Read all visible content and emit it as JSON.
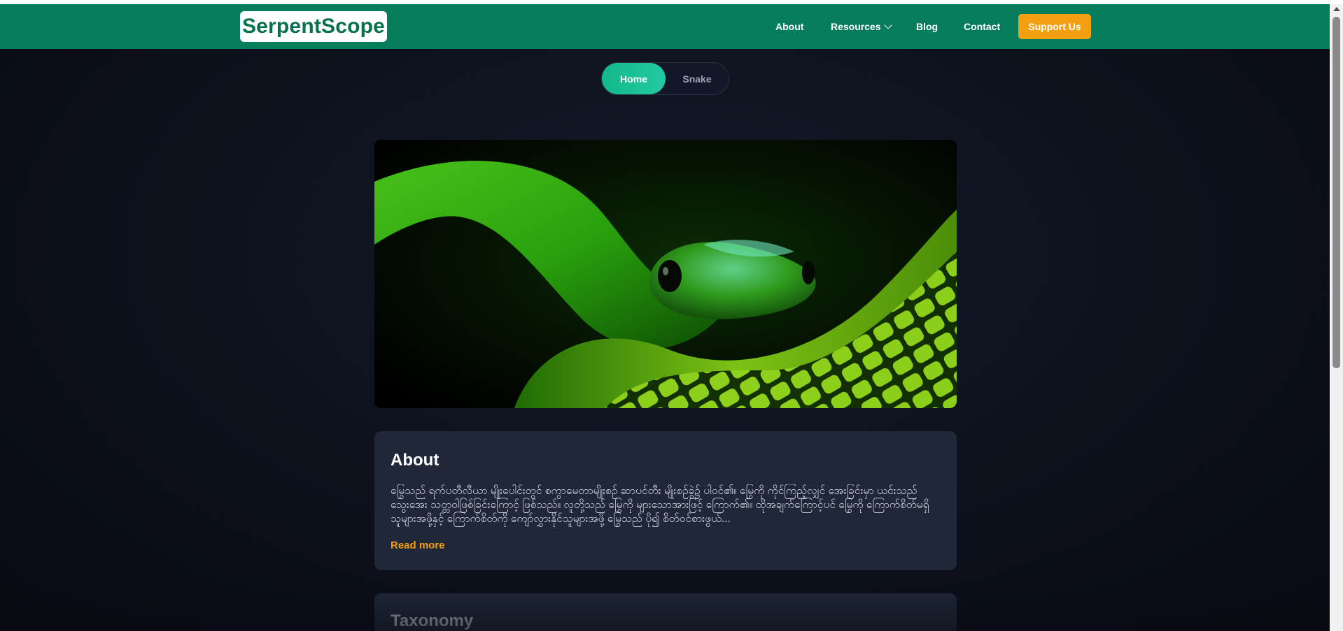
{
  "navbar": {
    "logo": "SerpentScope",
    "links": {
      "about": "About",
      "resources": "Resources",
      "blog": "Blog",
      "contact": "Contact"
    },
    "cta": "Support Us"
  },
  "tabs": {
    "home": "Home",
    "snake": "Snake"
  },
  "about_card": {
    "title": "About",
    "text": "မြွေသည် ရက်ပတီလီယာ မျိုးပေါင်းတွင် စကွာမေတာမျိုးစဉ် ဆာပင်တီး မျိုးစဉ်ခွဲ၌ ပါဝင်၏။ မြွေကို ကိုင်ကြည့်လျှင် အေးခြင်းမှာ ယင်းသည် သွေးအေး သတ္တဝါဖြစ်ခြင်းကြောင့် ဖြစ်သည်။ လူတို့သည် မြွေကို များသောအားဖြင့် ကြောက်၏။ ထိုအချက်ကြောင့်ပင် မြွေကို ကြောက်စိတ်မရှိသူများအဖို့နှင့် ကြောက်စိတ်ကို ကျော်လွှားနိုင်သူများအဖို့ မြွေသည် ပို၍ စိတ်ဝင်စားဖွယ်...",
    "read_more": "Read more"
  },
  "taxonomy_card": {
    "title": "Taxonomy"
  },
  "colors": {
    "nav_bg": "#057d5b",
    "accent": "#f2a00f",
    "tab_active": "#13b889",
    "card_bg": "#1f2738"
  },
  "icons": {
    "resources_dropdown": "chevron-down-icon"
  }
}
